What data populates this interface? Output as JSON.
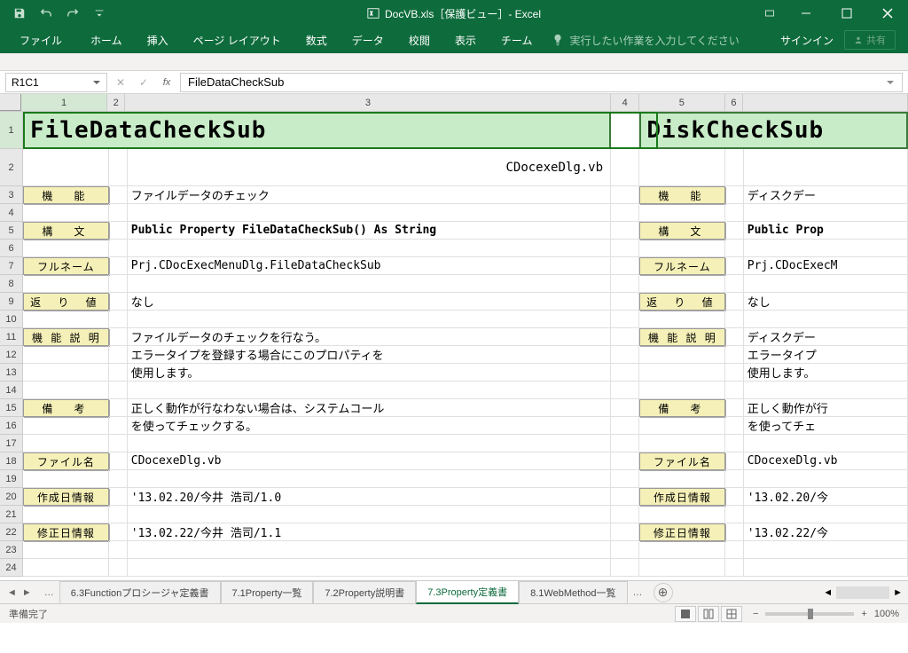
{
  "title": "DocVB.xls［保護ビュー］- Excel",
  "qat": {
    "save": "保存",
    "undo": "元に戻す",
    "redo": "やり直し"
  },
  "win": {
    "signin": "サインイン",
    "share": "共有"
  },
  "tabs": {
    "file": "ファイル",
    "home": "ホーム",
    "insert": "挿入",
    "layout": "ページ レイアウト",
    "formulas": "数式",
    "data": "データ",
    "review": "校閲",
    "view": "表示",
    "team": "チーム",
    "tellme": "実行したい作業を入力してください"
  },
  "namebox": "R1C1",
  "formula": "FileDataCheckSub",
  "cols": [
    "1",
    "2",
    "3",
    "4",
    "5",
    "6"
  ],
  "rows": [
    "1",
    "2",
    "3",
    "4",
    "5",
    "6",
    "7",
    "8",
    "9",
    "10",
    "11",
    "12",
    "13",
    "14",
    "15",
    "16",
    "17",
    "18",
    "19",
    "20",
    "21",
    "22",
    "23",
    "24"
  ],
  "left": {
    "header": "FileDataCheckSub",
    "subtitle": "CDocexeDlg.vb",
    "labels": {
      "func": "機　能",
      "syntax": "構　文",
      "fullname": "フルネーム",
      "retval": "返 り 値",
      "desc": "機 能 説 明",
      "notes": "備　考",
      "filename": "ファイル名",
      "created": "作成日情報",
      "modified": "修正日情報"
    },
    "vals": {
      "func": "ファイルデータのチェック",
      "syntax": "Public Property FileDataCheckSub() As String",
      "fullname": "Prj.CDocExecMenuDlg.FileDataCheckSub",
      "retval": "なし",
      "desc1": "ファイルデータのチェックを行なう。",
      "desc2": "エラータイプを登録する場合にこのプロパティを",
      "desc3": "使用します。",
      "notes1": "正しく動作が行なわない場合は、システムコール",
      "notes2": "を使ってチェックする。",
      "filename": "CDocexeDlg.vb",
      "created": "'13.02.20/今井 浩司/1.0",
      "modified": "'13.02.22/今井 浩司/1.1"
    }
  },
  "right": {
    "header": "DiskCheckSub",
    "labels": {
      "func": "機　能",
      "syntax": "構　文",
      "fullname": "フルネーム",
      "retval": "返 り 値",
      "desc": "機 能 説 明",
      "notes": "備　考",
      "filename": "ファイル名",
      "created": "作成日情報",
      "modified": "修正日情報"
    },
    "vals": {
      "func": "ディスクデー",
      "syntax": "Public Prop",
      "fullname": "Prj.CDocExecM",
      "retval": "なし",
      "desc1": "ディスクデー",
      "desc2": "エラータイプ",
      "desc3": "使用します。",
      "notes1": "正しく動作が行",
      "notes2": "を使ってチェ",
      "filename": "CDocexeDlg.vb",
      "created": "'13.02.20/今",
      "modified": "'13.02.22/今"
    }
  },
  "sheets": {
    "s1": "6.3Functionプロシージャ定義書",
    "s2": "7.1Property一覧",
    "s3": "7.2Property説明書",
    "s4": "7.3Property定義書",
    "s5": "8.1WebMethod一覧"
  },
  "status": "準備完了",
  "zoom": "100%"
}
